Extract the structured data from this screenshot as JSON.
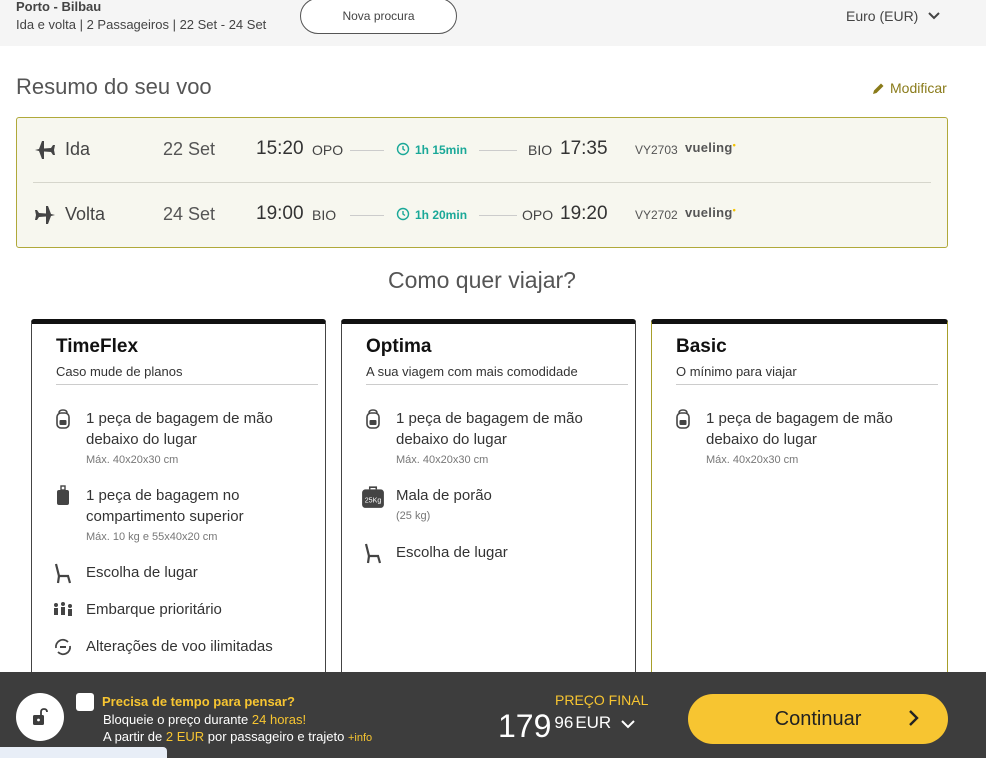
{
  "header": {
    "route": "Porto - Bilbau",
    "details": "Ida e volta | 2 Passageiros | 22 Set - 24 Set",
    "new_search": "Nova procura",
    "currency": "Euro (EUR)"
  },
  "summary": {
    "title": "Resumo do seu voo",
    "modify": "Modificar",
    "legs": [
      {
        "label": "Ida",
        "date": "22 Set",
        "dep_time": "15:20",
        "dep_code": "OPO",
        "duration": "1h 15min",
        "arr_code": "BIO",
        "arr_time": "17:35",
        "flight_no": "VY2703",
        "airline": "vueling"
      },
      {
        "label": "Volta",
        "date": "24 Set",
        "dep_time": "19:00",
        "dep_code": "BIO",
        "duration": "1h 20min",
        "arr_code": "OPO",
        "arr_time": "19:20",
        "flight_no": "VY2702",
        "airline": "vueling"
      }
    ]
  },
  "fares": {
    "title": "Como quer viajar?",
    "cards": [
      {
        "name": "TimeFlex",
        "subtitle": "Caso mude de planos",
        "features": [
          {
            "icon": "backpack-icon",
            "text": "1 peça de bagagem de mão debaixo do lugar",
            "note": "Máx. 40x20x30 cm"
          },
          {
            "icon": "trolley-bag-icon",
            "text": "1 peça de bagagem no compartimento superior",
            "note": "Máx. 10 kg e 55x40x20 cm"
          },
          {
            "icon": "seat-icon",
            "text": "Escolha de lugar",
            "note": ""
          },
          {
            "icon": "priority-boarding-icon",
            "text": "Embarque prioritário",
            "note": ""
          },
          {
            "icon": "flight-change-icon",
            "text": "Alterações de voo ilimitadas",
            "note": ""
          }
        ]
      },
      {
        "name": "Optima",
        "subtitle": "A sua viagem com mais comodidade",
        "features": [
          {
            "icon": "backpack-icon",
            "text": "1 peça de bagagem de mão debaixo do lugar",
            "note": "Máx. 40x20x30 cm"
          },
          {
            "icon": "checked-bag-25kg-icon",
            "text": "Mala de porão",
            "note": "(25 kg)",
            "badge": "25Kg"
          },
          {
            "icon": "seat-icon",
            "text": "Escolha de lugar",
            "note": ""
          }
        ]
      },
      {
        "name": "Basic",
        "subtitle": "O mínimo para viajar",
        "features": [
          {
            "icon": "backpack-icon",
            "text": "1 peça de bagagem de mão debaixo do lugar",
            "note": "Máx. 40x20x30 cm"
          }
        ]
      }
    ]
  },
  "footer": {
    "think_title": "Precisa de tempo para pensar?",
    "think_line2_prefix": "Bloqueie o preço durante ",
    "think_line2_highlight": "24 horas!",
    "think_line3_prefix": "A partir de ",
    "think_line3_highlight": "2 EUR",
    "think_line3_suffix": " por passageiro e trajeto ",
    "more_info": "+info",
    "final_label": "PREÇO FINAL",
    "price_int": "179",
    "price_dec": "96",
    "price_currency": "EUR",
    "continue": "Continuar"
  },
  "colors": {
    "accent": "#f7c531",
    "duration": "#1aa898",
    "modify": "#8a7b1a",
    "selected_border": "#a79f2a",
    "footer_bg": "#3d3d3d"
  }
}
